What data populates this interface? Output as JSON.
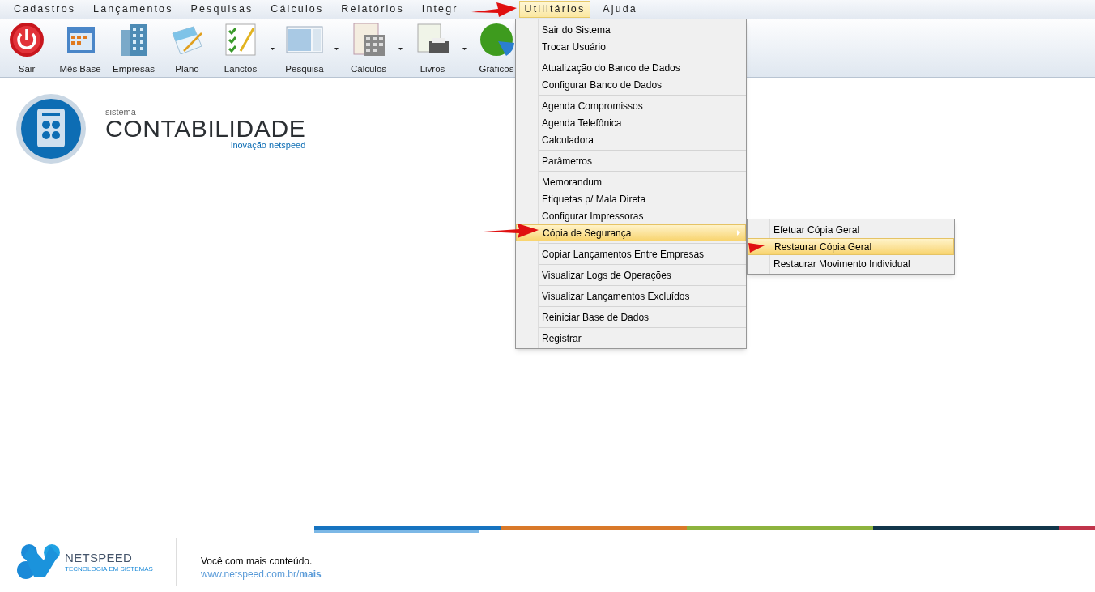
{
  "menu_bar": [
    {
      "label": "Cadastros",
      "selected": false
    },
    {
      "label": "Lançamentos",
      "selected": false
    },
    {
      "label": "Pesquisas",
      "selected": false
    },
    {
      "label": "Cálculos",
      "selected": false
    },
    {
      "label": "Relatórios",
      "selected": false
    },
    {
      "label": "Integr",
      "selected": false
    },
    {
      "label": "Utilitários",
      "selected": true
    },
    {
      "label": "Ajuda",
      "selected": false
    }
  ],
  "toolbar": [
    {
      "label": "Sair",
      "dropdown": false
    },
    {
      "label": "Mês Base",
      "dropdown": false
    },
    {
      "label": "Empresas",
      "dropdown": false
    },
    {
      "label": "Plano",
      "dropdown": false
    },
    {
      "label": "Lanctos",
      "dropdown": true
    },
    {
      "label": "Pesquisa",
      "dropdown": true
    },
    {
      "label": "Cálculos",
      "dropdown": true
    },
    {
      "label": "Livros",
      "dropdown": true
    },
    {
      "label": "Gráficos",
      "dropdown": false
    }
  ],
  "logo": {
    "overline": "sistema",
    "title": "CONTABILIDADE",
    "tagline": "inovação netspeed"
  },
  "utilitarios_menu": [
    [
      {
        "label": "Sair do Sistema",
        "selected": false,
        "submenu": false
      },
      {
        "label": "Trocar Usuário",
        "selected": false,
        "submenu": false
      }
    ],
    [
      {
        "label": "Atualização do Banco de Dados",
        "selected": false,
        "submenu": false
      },
      {
        "label": "Configurar Banco de Dados",
        "selected": false,
        "submenu": false
      }
    ],
    [
      {
        "label": "Agenda Compromissos",
        "selected": false,
        "submenu": false
      },
      {
        "label": "Agenda Telefônica",
        "selected": false,
        "submenu": false
      },
      {
        "label": "Calculadora",
        "selected": false,
        "submenu": false
      }
    ],
    [
      {
        "label": "Parâmetros",
        "selected": false,
        "submenu": false
      }
    ],
    [
      {
        "label": "Memorandum",
        "selected": false,
        "submenu": false
      },
      {
        "label": "Etiquetas p/ Mala Direta",
        "selected": false,
        "submenu": false
      },
      {
        "label": "Configurar Impressoras",
        "selected": false,
        "submenu": false
      },
      {
        "label": "Cópia de Segurança",
        "selected": true,
        "submenu": true
      }
    ],
    [
      {
        "label": "Copiar Lançamentos Entre Empresas",
        "selected": false,
        "submenu": false
      }
    ],
    [
      {
        "label": "Visualizar Logs de Operações",
        "selected": false,
        "submenu": false
      }
    ],
    [
      {
        "label": "Visualizar Lançamentos Excluídos",
        "selected": false,
        "submenu": false
      }
    ],
    [
      {
        "label": "Reiniciar Base de Dados",
        "selected": false,
        "submenu": false
      }
    ],
    [
      {
        "label": "Registrar",
        "selected": false,
        "submenu": false
      }
    ]
  ],
  "copia_submenu": [
    {
      "label": "Efetuar Cópia Geral",
      "selected": false
    },
    {
      "label": "Restaurar Cópia Geral",
      "selected": true
    },
    {
      "label": "Restaurar Movimento Individual",
      "selected": false
    }
  ],
  "footer": {
    "brand": "NETSPEED",
    "brand_tagline": "TECNOLOGIA EM SISTEMAS",
    "message": "Você com mais conteúdo.",
    "link_prefix": "www.netspeed.com.br/",
    "link_bold": "mais"
  }
}
